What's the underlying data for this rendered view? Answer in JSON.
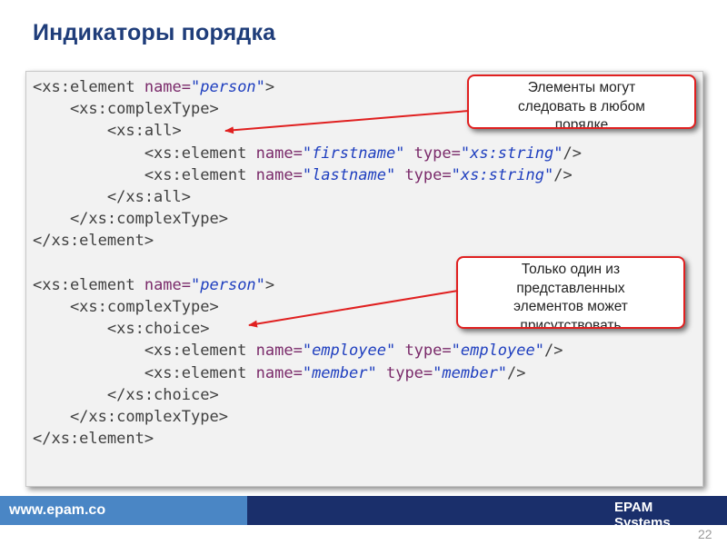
{
  "slide": {
    "title": "Индикаторы порядка",
    "page_number": "22"
  },
  "code_block_1": {
    "lines": [
      [
        {
          "t": "<xs:element "
        },
        {
          "t": "name=",
          "c": "attr"
        },
        {
          "t": "\"person\"",
          "c": "val"
        },
        {
          "t": ">"
        }
      ],
      [
        {
          "t": "    <xs:complexType>"
        }
      ],
      [
        {
          "t": "        <xs:all>"
        }
      ],
      [
        {
          "t": "            <xs:element "
        },
        {
          "t": "name=",
          "c": "attr"
        },
        {
          "t": "\"firstname\"",
          "c": "val"
        },
        {
          "t": " "
        },
        {
          "t": "type=",
          "c": "attr"
        },
        {
          "t": "\"xs:string\"",
          "c": "val"
        },
        {
          "t": "/>"
        }
      ],
      [
        {
          "t": "            <xs:element "
        },
        {
          "t": "name=",
          "c": "attr"
        },
        {
          "t": "\"lastname\"",
          "c": "val"
        },
        {
          "t": " "
        },
        {
          "t": "type=",
          "c": "attr"
        },
        {
          "t": "\"xs:string\"",
          "c": "val"
        },
        {
          "t": "/>"
        }
      ],
      [
        {
          "t": "        </xs:all>"
        }
      ],
      [
        {
          "t": "    </xs:complexType>"
        }
      ],
      [
        {
          "t": "</xs:element>"
        }
      ]
    ]
  },
  "code_block_2": {
    "lines": [
      [
        {
          "t": "<xs:element "
        },
        {
          "t": "name=",
          "c": "attr"
        },
        {
          "t": "\"person\"",
          "c": "val"
        },
        {
          "t": ">"
        }
      ],
      [
        {
          "t": "    <xs:complexType>"
        }
      ],
      [
        {
          "t": "        <xs:choice>"
        }
      ],
      [
        {
          "t": "            <xs:element "
        },
        {
          "t": "name=",
          "c": "attr"
        },
        {
          "t": "\"employee\"",
          "c": "val"
        },
        {
          "t": " "
        },
        {
          "t": "type=",
          "c": "attr"
        },
        {
          "t": "\"employee\"",
          "c": "val"
        },
        {
          "t": "/>"
        }
      ],
      [
        {
          "t": "            <xs:element "
        },
        {
          "t": "name=",
          "c": "attr"
        },
        {
          "t": "\"member\"",
          "c": "val"
        },
        {
          "t": " "
        },
        {
          "t": "type=",
          "c": "attr"
        },
        {
          "t": "\"member\"",
          "c": "val"
        },
        {
          "t": "/>"
        }
      ],
      [
        {
          "t": "        </xs:choice>"
        }
      ],
      [
        {
          "t": "    </xs:complexType>"
        }
      ],
      [
        {
          "t": "</xs:element>"
        }
      ]
    ]
  },
  "callout_1": {
    "lines": [
      "Элементы могут",
      "следовать в любом",
      "порядке"
    ]
  },
  "callout_2": {
    "lines": [
      "Только один из",
      "представленных",
      "элементов может",
      "присутствовать"
    ]
  },
  "footer": {
    "url": "www.epam.co",
    "brand_line_1": "EPAM",
    "brand_line_2": "Systems"
  },
  "colors": {
    "title": "#1f3d7a",
    "attribute": "#7a2a6a",
    "value": "#1f3fbf",
    "callout_border": "#e02020",
    "footer_dark": "#1a2f6b",
    "footer_light": "#4a86c5"
  }
}
